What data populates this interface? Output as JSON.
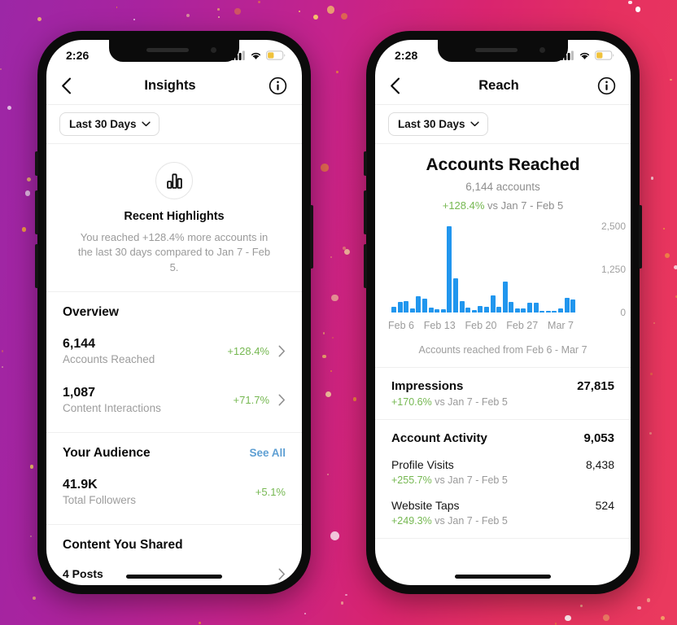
{
  "background": {
    "left_color": "#9c27a6",
    "right_color": "#ea3a5e",
    "confetti_colors": [
      "#f0a03c",
      "#f5c16a",
      "#e8823a",
      "#ffffff",
      "#f7d9a0"
    ]
  },
  "theme": {
    "accent_blue": "#2196ee",
    "positive_green": "#76b852",
    "link_blue": "#5e9fd3",
    "muted": "#9a9a9a"
  },
  "phone_left": {
    "status": {
      "time": "2:26",
      "icons": [
        "cellular-signal",
        "wifi",
        "battery"
      ]
    },
    "nav": {
      "back": "back-chevron",
      "title": "Insights",
      "info": "info-circle"
    },
    "filter": {
      "label": "Last 30 Days",
      "caret": "chevron-down"
    },
    "highlights": {
      "icon": "bar-chart-icon",
      "title": "Recent Highlights",
      "body": "You reached +128.4% more accounts in the last 30 days compared to Jan 7 - Feb 5."
    },
    "overview": {
      "title": "Overview",
      "rows": [
        {
          "value": "6,144",
          "label": "Accounts Reached",
          "delta": "+128.4%",
          "chevron": "chevron-right"
        },
        {
          "value": "1,087",
          "label": "Content Interactions",
          "delta": "+71.7%",
          "chevron": "chevron-right"
        }
      ]
    },
    "audience": {
      "title": "Your Audience",
      "see_all": "See All",
      "rows": [
        {
          "value": "41.9K",
          "label": "Total Followers",
          "delta": "+5.1%"
        }
      ]
    },
    "content_shared": {
      "title": "Content You Shared",
      "posts": "4 Posts",
      "chevron": "chevron-right"
    }
  },
  "phone_right": {
    "status": {
      "time": "2:28",
      "icons": [
        "cellular-signal",
        "wifi",
        "battery"
      ]
    },
    "nav": {
      "back": "back-chevron",
      "title": "Reach",
      "info": "info-circle"
    },
    "filter": {
      "label": "Last 30 Days",
      "caret": "chevron-down"
    },
    "reach": {
      "title": "Accounts Reached",
      "subtitle": "6,144 accounts",
      "delta": "+128.4%",
      "delta_vs": "vs Jan 7 - Feb 5",
      "caption": "Accounts reached from Feb 6 - Mar 7"
    },
    "impressions": {
      "name": "Impressions",
      "value": "27,815",
      "delta": "+170.6%",
      "delta_vs": "vs Jan 7 - Feb 5"
    },
    "account_activity": {
      "name": "Account Activity",
      "value": "9,053",
      "rows": [
        {
          "name": "Profile Visits",
          "value": "8,438",
          "delta": "+255.7%",
          "delta_vs": "vs Jan 7 - Feb 5"
        },
        {
          "name": "Website Taps",
          "value": "524",
          "delta": "+249.3%",
          "delta_vs": "vs Jan 7 - Feb 5"
        }
      ]
    }
  },
  "chart_data": {
    "type": "bar",
    "title": "Accounts Reached",
    "xlabel": "",
    "ylabel": "",
    "ylim": [
      0,
      2500
    ],
    "yticks": [
      0,
      1250,
      2500
    ],
    "ytick_labels": [
      "0",
      "1,250",
      "2,500"
    ],
    "grid": false,
    "legend": null,
    "xtick_labels": [
      "Feb 6",
      "Feb 13",
      "Feb 20",
      "Feb 27",
      "Mar 7"
    ],
    "annotation": "Accounts reached from Feb 6 - Mar 7",
    "bar_color": "#2196ee",
    "categories": [
      "Feb 6",
      "Feb 7",
      "Feb 8",
      "Feb 9",
      "Feb 10",
      "Feb 11",
      "Feb 12",
      "Feb 13",
      "Feb 14",
      "Feb 15",
      "Feb 16",
      "Feb 17",
      "Feb 18",
      "Feb 19",
      "Feb 20",
      "Feb 21",
      "Feb 22",
      "Feb 23",
      "Feb 24",
      "Feb 25",
      "Feb 26",
      "Feb 27",
      "Feb 28",
      "Mar 1",
      "Mar 2",
      "Mar 3",
      "Mar 4",
      "Mar 5",
      "Mar 6",
      "Mar 7"
    ],
    "values": [
      170,
      300,
      330,
      110,
      470,
      400,
      150,
      90,
      100,
      2500,
      980,
      330,
      150,
      80,
      180,
      160,
      500,
      170,
      900,
      300,
      110,
      110,
      290,
      290,
      20,
      20,
      20,
      120,
      420,
      380
    ]
  }
}
